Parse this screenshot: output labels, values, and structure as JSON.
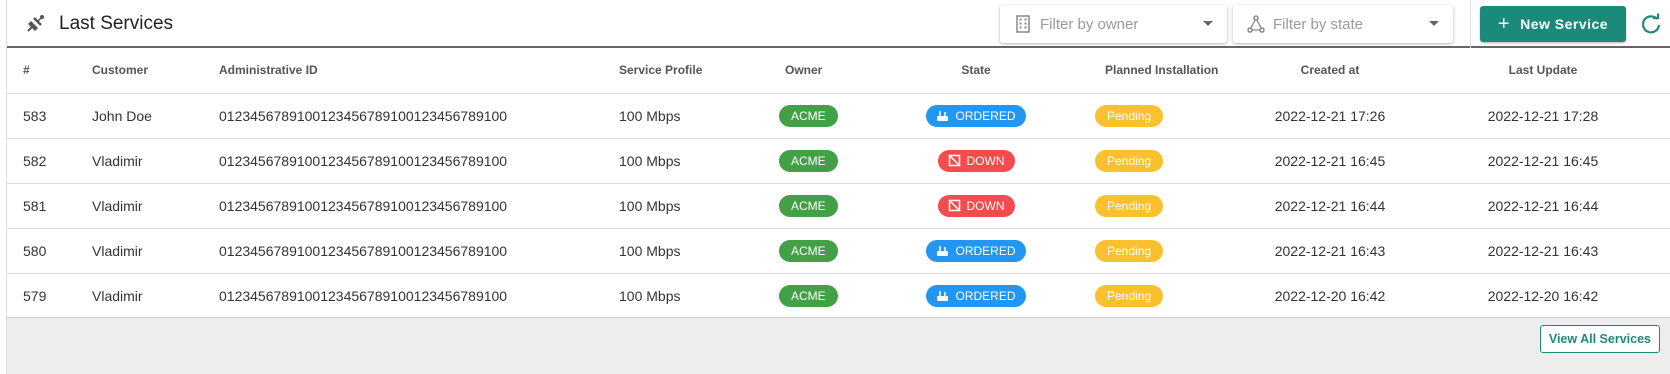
{
  "header": {
    "title": "Last Services",
    "title_icon": "satellite-dish-icon",
    "filter_owner_placeholder": "Filter by owner",
    "filter_state_placeholder": "Filter by state",
    "new_service_label": "New Service"
  },
  "columns": [
    "#",
    "Customer",
    "Administrative ID",
    "Service Profile",
    "Owner",
    "State",
    "Planned Installation",
    "Created at",
    "Last Update"
  ],
  "rows": [
    {
      "num": "583",
      "customer": "John Doe",
      "admin_id": "0123456789100123456789100123456789100",
      "profile": "100 Mbps",
      "owner": "ACME",
      "state": "ORDERED",
      "planned": "Pending",
      "created": "2022-12-21 17:26",
      "updated": "2022-12-21 17:28"
    },
    {
      "num": "582",
      "customer": "Vladimir",
      "admin_id": "0123456789100123456789100123456789100",
      "profile": "100 Mbps",
      "owner": "ACME",
      "state": "DOWN",
      "planned": "Pending",
      "created": "2022-12-21 16:45",
      "updated": "2022-12-21 16:45"
    },
    {
      "num": "581",
      "customer": "Vladimir",
      "admin_id": "0123456789100123456789100123456789100",
      "profile": "100 Mbps",
      "owner": "ACME",
      "state": "DOWN",
      "planned": "Pending",
      "created": "2022-12-21 16:44",
      "updated": "2022-12-21 16:44"
    },
    {
      "num": "580",
      "customer": "Vladimir",
      "admin_id": "0123456789100123456789100123456789100",
      "profile": "100 Mbps",
      "owner": "ACME",
      "state": "ORDERED",
      "planned": "Pending",
      "created": "2022-12-21 16:43",
      "updated": "2022-12-21 16:43"
    },
    {
      "num": "579",
      "customer": "Vladimir",
      "admin_id": "0123456789100123456789100123456789100",
      "profile": "100 Mbps",
      "owner": "ACME",
      "state": "ORDERED",
      "planned": "Pending",
      "created": "2022-12-20 16:42",
      "updated": "2022-12-20 16:42"
    }
  ],
  "footer": {
    "view_all_label": "View All Services"
  },
  "colors": {
    "accent": "#1b8a78",
    "owner_badge": "#43a047",
    "ordered_badge": "#2196f3",
    "down_badge": "#f44c4c",
    "pending_badge": "#fbc02d"
  }
}
